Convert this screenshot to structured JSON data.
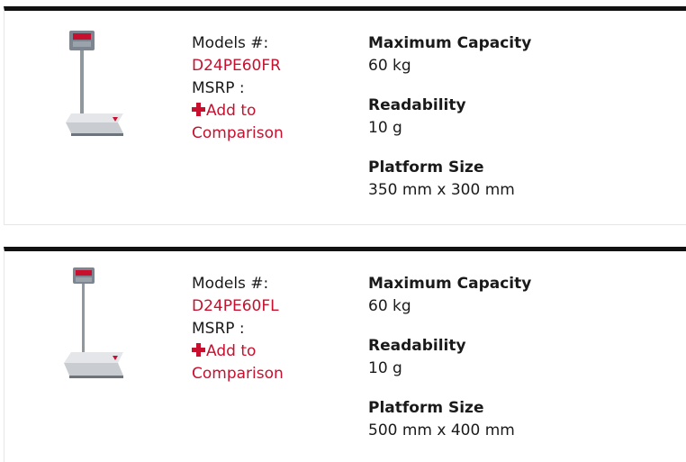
{
  "products": [
    {
      "models_label": "Models #:",
      "model_number": "D24PE60FR",
      "msrp_label": "MSRP :",
      "compare_label_1": "Add to",
      "compare_label_2": "Comparison",
      "image_icon": "bench-scale-image",
      "specs": [
        {
          "title": "Maximum Capacity",
          "value": "60 kg"
        },
        {
          "title": "Readability",
          "value": "10 g"
        },
        {
          "title": "Platform Size",
          "value": "350 mm x 300 mm"
        }
      ]
    },
    {
      "models_label": "Models #:",
      "model_number": "D24PE60FL",
      "msrp_label": "MSRP :",
      "compare_label_1": "Add to",
      "compare_label_2": "Comparison",
      "image_icon": "bench-scale-image",
      "specs": [
        {
          "title": "Maximum Capacity",
          "value": "60 kg"
        },
        {
          "title": "Readability",
          "value": "10 g"
        },
        {
          "title": "Platform Size",
          "value": "500 mm x 400 mm"
        }
      ]
    }
  ],
  "colors": {
    "link": "#c8102e",
    "divider": "#111111",
    "text": "#1a1a1a"
  }
}
